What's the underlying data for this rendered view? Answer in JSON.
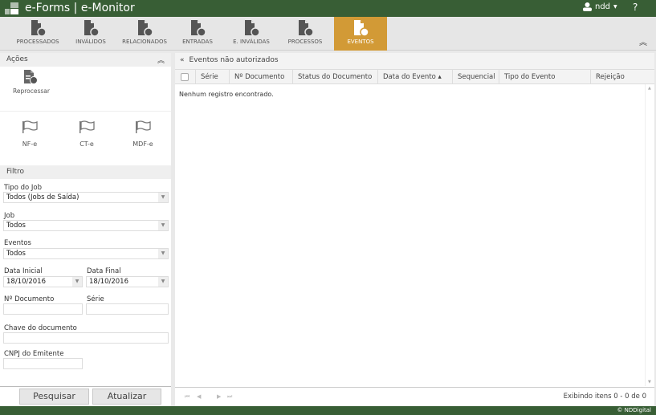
{
  "header": {
    "title": "e-Forms | e-Monitor",
    "user": "ndd",
    "help": "?"
  },
  "toolbar": {
    "tabs": [
      {
        "label": "PROCESSADOS",
        "icon": "doc-up-check-icon"
      },
      {
        "label": "INVÁLIDOS",
        "icon": "doc-up-x-icon"
      },
      {
        "label": "RELACIONADOS",
        "icon": "doc-clip-icon"
      },
      {
        "label": "ENTRADAS",
        "icon": "doc-down-check-icon"
      },
      {
        "label": "E. INVÁLIDAS",
        "icon": "doc-down-x-icon"
      },
      {
        "label": "PROCESSOS",
        "icon": "doc-gear-icon"
      },
      {
        "label": "EVENTOS",
        "icon": "doc-event-icon",
        "active": true
      }
    ],
    "accent": "#d29a36"
  },
  "acoes": {
    "title": "Ações",
    "reprocessar": "Reprocessar",
    "flags": [
      "NF-e",
      "CT-e",
      "MDF-e"
    ]
  },
  "filtro": {
    "title": "Filtro",
    "tipo_job_label": "Tipo do Job",
    "tipo_job": "Todos (Jobs de Saída)",
    "job_label": "Job",
    "job": "Todos",
    "eventos_label": "Eventos",
    "eventos": "Todos",
    "data_inicial_label": "Data Inicial",
    "data_inicial": "18/10/2016",
    "data_final_label": "Data Final",
    "data_final": "18/10/2016",
    "documento_label": "Nº Documento",
    "serie_label": "Série",
    "chave_label": "Chave do documento",
    "cnpj_label": "CNPJ do Emitente",
    "pesquisar": "Pesquisar",
    "atualizar": "Atualizar"
  },
  "grid": {
    "title": "Eventos não autorizados",
    "columns": [
      "Série",
      "Nº Documento",
      "Status do Documento",
      "Data do Evento ▴",
      "Sequencial",
      "Tipo do Evento",
      "Rejeição"
    ],
    "empty": "Nenhum registro encontrado.",
    "pager_info": "Exibindo itens 0 - 0 de 0"
  },
  "footer": {
    "copyright": "© NDDigital"
  },
  "colors": {
    "header": "#385e35",
    "active_tab": "#d29a36"
  }
}
